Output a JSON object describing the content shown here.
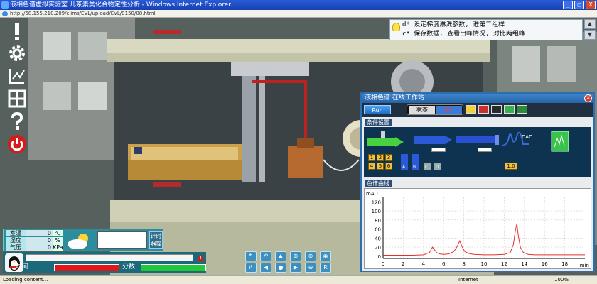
{
  "window": {
    "title": "液相色谱虚拟实验室 儿茶素类化合物定性分析 - Windows Internet Explorer",
    "address": "http://58.155.210.209/clims/EVL/upload/EVL/0150/08.html",
    "buttons": {
      "minimize": "_",
      "maximize": "□",
      "close": "X"
    }
  },
  "hints": {
    "lines": [
      "d*.设定梯度淋洗参数, 进第二组样",
      "c*.保存数据, 查看出峰情况, 对比两组峰"
    ]
  },
  "panel": {
    "title": "液相色谱 在线工作站",
    "run_label": "Run",
    "status_label": "状态",
    "status_value": "洗针",
    "conditions_label": "条件设置",
    "curve_label": "色谱曲线",
    "num_keys": [
      "1",
      "2",
      "3",
      "4",
      "5",
      "6"
    ],
    "module_labels": {
      "dad": "DAD",
      "pump_a": "A",
      "pump_b": "B",
      "pump_c": "C",
      "pump_d": "D",
      "detector_readout": "1.0"
    }
  },
  "chart_data": {
    "type": "line",
    "ylabel": "mAU",
    "xlabel": "min",
    "xlim": [
      0,
      20
    ],
    "ylim": [
      -5,
      130
    ],
    "yticks": [
      0,
      20,
      40,
      60,
      80,
      100,
      120
    ],
    "xticks": [
      0,
      2,
      4,
      6,
      8,
      10,
      12,
      14,
      16,
      18
    ],
    "grid": true,
    "series": [
      {
        "color": "#e23030",
        "x": [
          0,
          1,
          2,
          3,
          4,
          4.6,
          4.9,
          5.1,
          5.3,
          5.6,
          6.0,
          6.5,
          7.0,
          7.3,
          7.6,
          7.8,
          8.1,
          8.5,
          9,
          10,
          11,
          12,
          12.6,
          12.9,
          13.1,
          13.25,
          13.4,
          13.6,
          13.9,
          14.4,
          15,
          16,
          17,
          18,
          19,
          20
        ],
        "y": [
          2,
          2,
          2,
          2,
          3,
          8,
          20,
          14,
          8,
          5,
          4,
          5,
          10,
          20,
          34,
          22,
          10,
          6,
          4,
          3,
          3,
          4,
          8,
          25,
          55,
          72,
          45,
          20,
          8,
          4,
          3,
          3,
          3,
          3,
          3,
          3
        ]
      }
    ]
  },
  "environment": {
    "rows": [
      {
        "label": "室温",
        "value": "0",
        "unit": "℃"
      },
      {
        "label": "湿度",
        "value": "0",
        "unit": "%"
      },
      {
        "label": "气压",
        "value": "0",
        "unit": "KPa"
      }
    ],
    "timer_label": "计时\n器操"
  },
  "progress": {
    "time_label": "时间",
    "score_label": "分数",
    "time_fraction": 1.0,
    "score_fraction": 1.0,
    "time_color": "#e01818",
    "score_color": "#22c83a"
  },
  "nav": {
    "buttons": [
      "↰",
      "↶",
      "▲",
      "⊕",
      "⊕",
      "◉",
      "↱",
      "◀",
      "●",
      "▶",
      "⊖",
      "R"
    ]
  },
  "statusbar": {
    "left": "Loading content...",
    "zone": "Internet",
    "zoom": "100%"
  }
}
